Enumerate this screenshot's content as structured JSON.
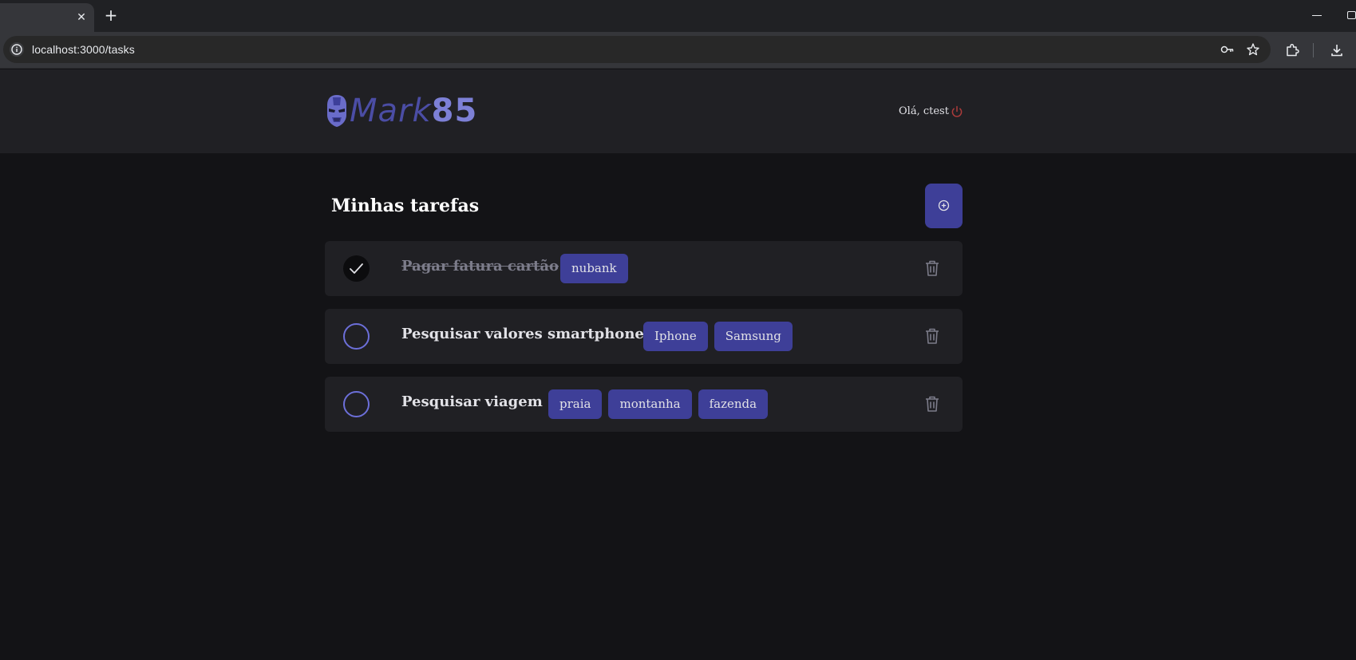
{
  "browser": {
    "url": "localhost:3000/tasks",
    "close_tab_glyph": "✕",
    "new_tab_glyph": "+"
  },
  "header": {
    "brand_main": "Mark",
    "brand_accent": "85",
    "greeting": "Olá, ctest"
  },
  "page": {
    "title": "Minhas tarefas"
  },
  "tasks": [
    {
      "title": "Pagar fatura cartão",
      "done": true,
      "tags": [
        "nubank"
      ]
    },
    {
      "title": "Pesquisar valores smartphone",
      "done": false,
      "tags": [
        "Iphone",
        "Samsung"
      ]
    },
    {
      "title": "Pesquisar viagem",
      "done": false,
      "tags": [
        "praia",
        "montanha",
        "fazenda"
      ]
    }
  ],
  "colors": {
    "accent": "#3e3f98",
    "check_ring": "#6c6fd9",
    "logout": "#ab3b3b",
    "background": "#131316",
    "card": "#202024"
  },
  "icons": {
    "logo": "iron-helmet-icon",
    "logout": "power-icon",
    "add": "plus-circle-icon",
    "done": "checkmark-icon",
    "delete": "trash-icon"
  }
}
